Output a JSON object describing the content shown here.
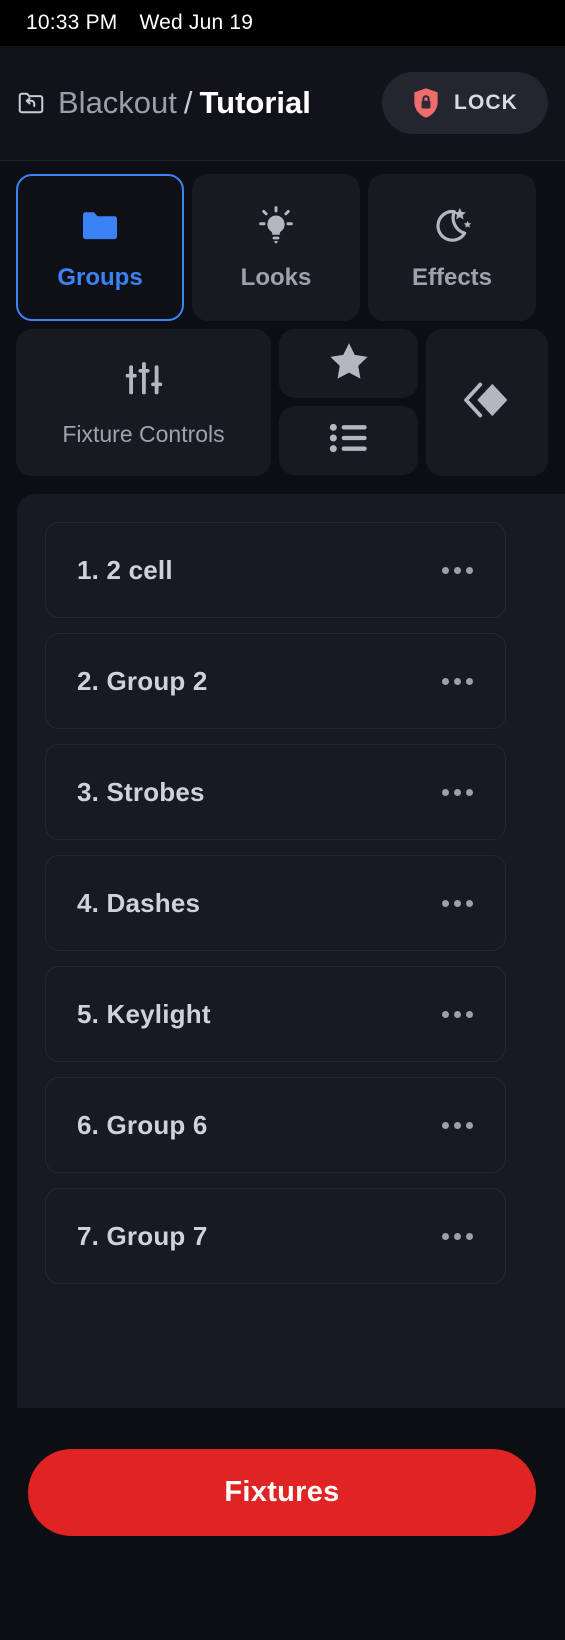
{
  "statusbar": {
    "time": "10:33 PM",
    "date": "Wed Jun 19"
  },
  "header": {
    "back_icon": "folder-back-icon",
    "breadcrumb_parent": "Blackout",
    "breadcrumb_separator": "/",
    "breadcrumb_current": "Tutorial",
    "lock_label": "LOCK",
    "lock_icon": "shield-lock-icon"
  },
  "colors": {
    "accent_blue": "#3b82f6",
    "danger_red": "#e02423",
    "shield_red": "#ef6c6c",
    "page_bg": "#0d0e14",
    "tile_bg": "#181a22",
    "panel_bg": "#171923",
    "text_muted": "#9ea1af"
  },
  "tabs": [
    {
      "label": "Groups",
      "icon": "folder-icon",
      "selected": true
    },
    {
      "label": "Looks",
      "icon": "lightbulb-icon",
      "selected": false
    },
    {
      "label": "Effects",
      "icon": "moon-stars-icon",
      "selected": false
    }
  ],
  "tools": {
    "fixture_controls": {
      "label": "Fixture Controls",
      "icon": "sliders-icon"
    },
    "favorites": {
      "icon": "star-icon"
    },
    "list_view": {
      "icon": "list-icon"
    },
    "layers": {
      "icon": "layers-diamond-icon"
    }
  },
  "groups": [
    {
      "label": "1. 2 cell",
      "menu_icon": "ellipsis-icon"
    },
    {
      "label": "2. Group 2",
      "menu_icon": "ellipsis-icon"
    },
    {
      "label": "3. Strobes",
      "menu_icon": "ellipsis-icon"
    },
    {
      "label": "4. Dashes",
      "menu_icon": "ellipsis-icon"
    },
    {
      "label": "5. Keylight",
      "menu_icon": "ellipsis-icon"
    },
    {
      "label": "6. Group 6",
      "menu_icon": "ellipsis-icon"
    },
    {
      "label": "7. Group 7",
      "menu_icon": "ellipsis-icon"
    }
  ],
  "bottom": {
    "fixtures_label": "Fixtures"
  }
}
